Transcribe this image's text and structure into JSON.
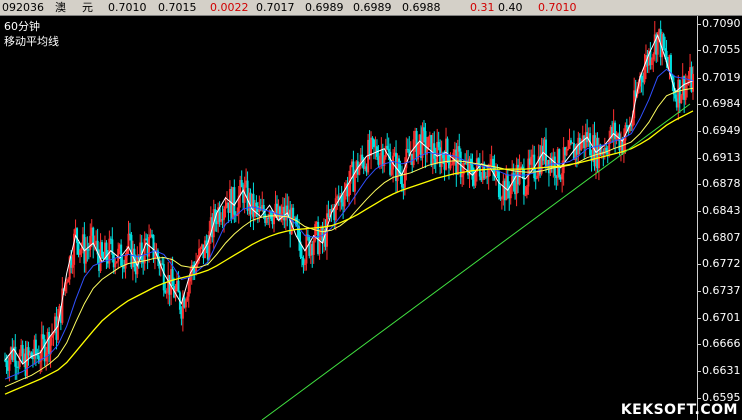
{
  "topbar": {
    "code": "092036",
    "name1": "澳",
    "name2": "元",
    "open": "0.7010",
    "high": "0.7015",
    "change": "0.0022",
    "last": "0.7017",
    "low": "0.6989",
    "bid": "0.6989",
    "ask": "0.6988",
    "vol": "0.31",
    "amount": "0.40",
    "prev": "0.7010",
    "change_color": "#d00000"
  },
  "chart_header": {
    "period": "60分钟",
    "indicator": "移动平均线"
  },
  "watermark": "KEKSOFT.COM",
  "chart_data": {
    "type": "line",
    "ylim": [
      0.6595,
      0.709
    ],
    "yticks": [
      "0.7090",
      "0.7055",
      "0.7019",
      "0.6984",
      "0.6949",
      "0.6913",
      "0.6878",
      "0.6843",
      "0.6807",
      "0.6772",
      "0.6737",
      "0.6701",
      "0.6666",
      "0.6631",
      "0.6595"
    ],
    "colors": {
      "up": "#ff3030",
      "down": "#00e0e0",
      "ma_short": "#ffffff",
      "ma_mid": "#ffff60",
      "ma_blue": "#3050ff",
      "ma_long": "#ffff00",
      "trendline": "#40e040"
    },
    "series": [
      {
        "values": [
          0.6645,
          0.666,
          0.664,
          0.665,
          0.6655,
          0.6675,
          0.669,
          0.676,
          0.681,
          0.679,
          0.68,
          0.6775,
          0.679,
          0.678,
          0.6795,
          0.677,
          0.68,
          0.679,
          0.676,
          0.674,
          0.672,
          0.676,
          0.678,
          0.68,
          0.684,
          0.686,
          0.685,
          0.687,
          0.6845,
          0.6835,
          0.685,
          0.683,
          0.684,
          0.681,
          0.679,
          0.681,
          0.68,
          0.684,
          0.686,
          0.688,
          0.69,
          0.6915,
          0.692,
          0.6925,
          0.6905,
          0.689,
          0.692,
          0.6935,
          0.6925,
          0.6915,
          0.692,
          0.691,
          0.69,
          0.689,
          0.6905,
          0.69,
          0.688,
          0.687,
          0.689,
          0.6885,
          0.69,
          0.692,
          0.691,
          0.69,
          0.6915,
          0.693,
          0.694,
          0.692,
          0.693,
          0.6945,
          0.6935,
          0.696,
          0.702,
          0.705,
          0.7075,
          0.704,
          0.7,
          0.701,
          0.7015
        ]
      },
      {
        "values": [
          0.662,
          0.6625,
          0.663,
          0.6638,
          0.6645,
          0.6652,
          0.6665,
          0.669,
          0.6725,
          0.6755,
          0.677,
          0.6775,
          0.6778,
          0.6782,
          0.6785,
          0.6782,
          0.6785,
          0.679,
          0.6785,
          0.677,
          0.6752,
          0.6755,
          0.6765,
          0.6775,
          0.68,
          0.6825,
          0.6835,
          0.6845,
          0.6848,
          0.6845,
          0.6842,
          0.6838,
          0.6835,
          0.6825,
          0.681,
          0.6808,
          0.681,
          0.682,
          0.6835,
          0.685,
          0.6868,
          0.6885,
          0.6898,
          0.6905,
          0.6908,
          0.6905,
          0.6908,
          0.6915,
          0.692,
          0.6918,
          0.6918,
          0.6915,
          0.691,
          0.6905,
          0.6902,
          0.69,
          0.6895,
          0.689,
          0.689,
          0.689,
          0.6893,
          0.69,
          0.6905,
          0.6905,
          0.6908,
          0.6915,
          0.6925,
          0.6928,
          0.693,
          0.6935,
          0.6938,
          0.6945,
          0.6965,
          0.699,
          0.702,
          0.703,
          0.702,
          0.7018,
          0.7015
        ]
      },
      {
        "values": [
          0.661,
          0.6615,
          0.662,
          0.6625,
          0.6632,
          0.664,
          0.665,
          0.6668,
          0.6695,
          0.672,
          0.674,
          0.6752,
          0.676,
          0.6768,
          0.6773,
          0.6775,
          0.6777,
          0.678,
          0.6781,
          0.6778,
          0.677,
          0.6768,
          0.6768,
          0.6772,
          0.6785,
          0.68,
          0.6812,
          0.6822,
          0.683,
          0.6834,
          0.6836,
          0.6836,
          0.6835,
          0.683,
          0.6822,
          0.6818,
          0.6815,
          0.6817,
          0.6823,
          0.6832,
          0.6845,
          0.6858,
          0.687,
          0.688,
          0.6887,
          0.689,
          0.6893,
          0.6898,
          0.6903,
          0.6906,
          0.6908,
          0.6909,
          0.6908,
          0.6906,
          0.6904,
          0.6902,
          0.69,
          0.6897,
          0.6895,
          0.6894,
          0.6894,
          0.6896,
          0.6899,
          0.6901,
          0.6903,
          0.6907,
          0.6913,
          0.6917,
          0.692,
          0.6925,
          0.6929,
          0.6934,
          0.6945,
          0.696,
          0.698,
          0.6995,
          0.7,
          0.7003,
          0.7005
        ]
      },
      {
        "values": [
          0.66,
          0.6605,
          0.661,
          0.6615,
          0.662,
          0.6626,
          0.6632,
          0.6642,
          0.6656,
          0.667,
          0.6684,
          0.6697,
          0.6707,
          0.6716,
          0.6724,
          0.673,
          0.6736,
          0.6742,
          0.6747,
          0.6751,
          0.6754,
          0.6757,
          0.676,
          0.6764,
          0.677,
          0.6777,
          0.6784,
          0.6791,
          0.6798,
          0.6804,
          0.6809,
          0.6813,
          0.6816,
          0.6818,
          0.6819,
          0.682,
          0.6821,
          0.6823,
          0.6827,
          0.6832,
          0.6838,
          0.6845,
          0.6852,
          0.6859,
          0.6865,
          0.687,
          0.6874,
          0.6878,
          0.6882,
          0.6886,
          0.6889,
          0.6892,
          0.6894,
          0.6896,
          0.6897,
          0.6898,
          0.6898,
          0.6898,
          0.6898,
          0.6898,
          0.6899,
          0.69,
          0.6901,
          0.6902,
          0.6904,
          0.6906,
          0.6909,
          0.6912,
          0.6915,
          0.6918,
          0.6921,
          0.6925,
          0.6931,
          0.6938,
          0.6947,
          0.6956,
          0.6963,
          0.6969,
          0.6975
        ]
      }
    ]
  }
}
